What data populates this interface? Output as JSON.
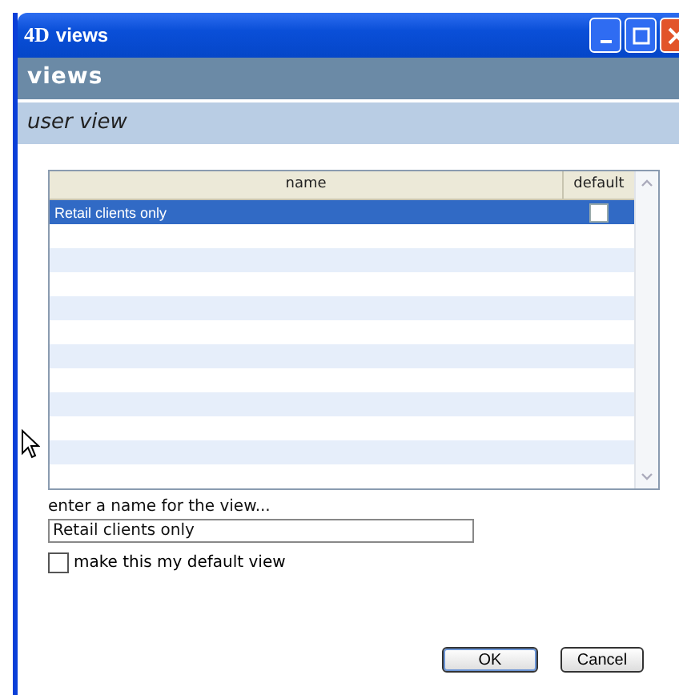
{
  "window": {
    "logo": "4D",
    "title": "views"
  },
  "header": {
    "title": "views",
    "subtitle": "user view"
  },
  "table": {
    "columns": [
      "name",
      "default"
    ],
    "rows": [
      {
        "name": "Retail clients only",
        "default": false,
        "selected": true
      }
    ]
  },
  "name_field": {
    "label": "enter a name for the view...",
    "value": "Retail clients only"
  },
  "default_checkbox": {
    "label": "make this my default view",
    "checked": false
  },
  "buttons": [
    {
      "label": "OK",
      "kind": "default"
    },
    {
      "label": "Cancel",
      "kind": "normal"
    }
  ]
}
